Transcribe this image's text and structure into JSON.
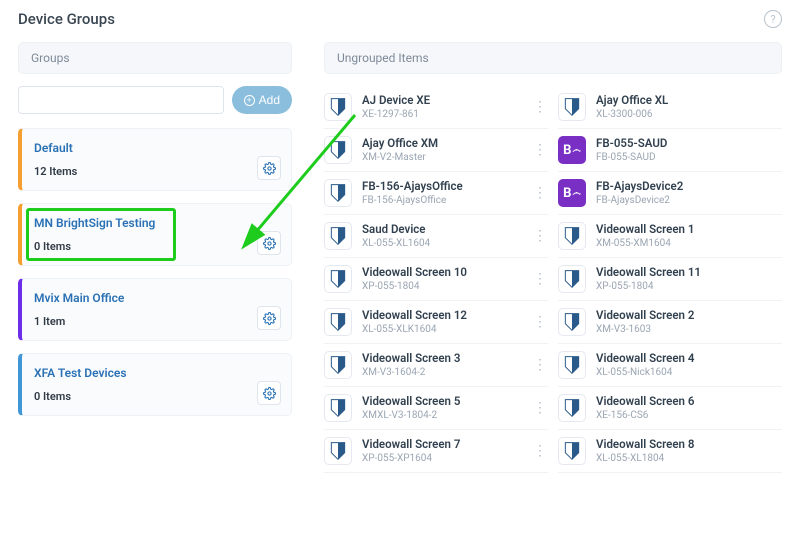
{
  "header": {
    "title": "Device Groups"
  },
  "groups": {
    "label": "Groups",
    "add_button": "Add",
    "items": [
      {
        "name": "Default",
        "count": "12 Items"
      },
      {
        "name": "MN BrightSign Testing",
        "count": "0 Items"
      },
      {
        "name": "Mvix Main Office",
        "count": "1 Item"
      },
      {
        "name": "XFA Test Devices",
        "count": "0 Items"
      }
    ]
  },
  "ungrouped": {
    "label": "Ungrouped Items",
    "items": [
      {
        "name": "AJ Device XE",
        "sub": "XE-1297-861",
        "type": "shield"
      },
      {
        "name": "Ajay Office XL",
        "sub": "XL-3300-006",
        "type": "shield"
      },
      {
        "name": "Ajay Office XM",
        "sub": "XM-V2-Master",
        "type": "shield"
      },
      {
        "name": "FB-055-SAUD",
        "sub": "FB-055-SAUD",
        "type": "purple"
      },
      {
        "name": "FB-156-AjaysOffice",
        "sub": "FB-156-AjaysOffice",
        "type": "shield"
      },
      {
        "name": "FB-AjaysDevice2",
        "sub": "FB-AjaysDevice2",
        "type": "purple"
      },
      {
        "name": "Saud Device",
        "sub": "XL-055-XL1604",
        "type": "shield"
      },
      {
        "name": "Videowall Screen 1",
        "sub": "XM-055-XM1604",
        "type": "shield"
      },
      {
        "name": "Videowall Screen 10",
        "sub": "XP-055-1804",
        "type": "shield"
      },
      {
        "name": "Videowall Screen 11",
        "sub": "XP-055-1804",
        "type": "shield"
      },
      {
        "name": "Videowall Screen 12",
        "sub": "XL-055-XLK1604",
        "type": "shield"
      },
      {
        "name": "Videowall Screen 2",
        "sub": "XM-V3-1603",
        "type": "shield"
      },
      {
        "name": "Videowall Screen 3",
        "sub": "XM-V3-1604-2",
        "type": "shield"
      },
      {
        "name": "Videowall Screen 4",
        "sub": "XL-055-Nick1604",
        "type": "shield"
      },
      {
        "name": "Videowall Screen 5",
        "sub": "XMXL-V3-1804-2",
        "type": "shield"
      },
      {
        "name": "Videowall Screen 6",
        "sub": "XE-156-CS6",
        "type": "shield"
      },
      {
        "name": "Videowall Screen 7",
        "sub": "XP-055-XP1604",
        "type": "shield"
      },
      {
        "name": "Videowall Screen 8",
        "sub": "XL-055-XL1804",
        "type": "shield"
      }
    ]
  },
  "annotation": {
    "highlight_group_index": 1
  }
}
